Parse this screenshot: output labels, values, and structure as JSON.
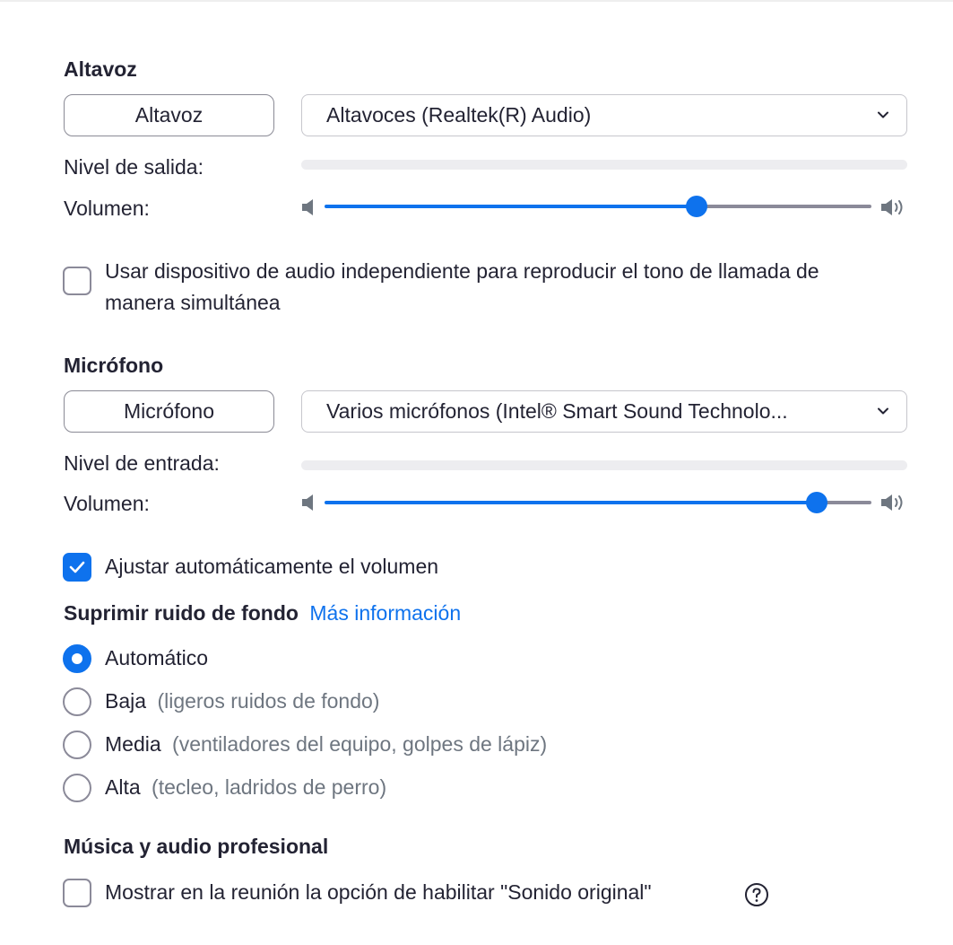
{
  "speaker": {
    "section_title": "Altavoz",
    "test_button": "Altavoz",
    "device": "Altavoces (Realtek(R) Audio)",
    "output_level_label": "Nivel de salida:",
    "output_level": 0,
    "volume_label": "Volumen:",
    "volume_fraction": 0.68
  },
  "separate_device": {
    "checked": false,
    "label_line1": "Usar dispositivo de audio independiente para reproducir el tono de llamada de",
    "label_line2": "manera simultánea"
  },
  "microphone": {
    "section_title": "Micrófono",
    "test_button": "Micrófono",
    "device": "Varios micrófonos (Intel® Smart Sound Technolo...",
    "input_level_label": "Nivel de entrada:",
    "input_level": 0,
    "volume_label": "Volumen:",
    "volume_fraction": 0.9
  },
  "auto_adjust": {
    "checked": true,
    "label": "Ajustar automáticamente el volumen"
  },
  "noise_suppression": {
    "title": "Suprimir ruido de fondo",
    "learn_more": "Más información",
    "options": [
      {
        "label": "Automático",
        "hint": "",
        "selected": true
      },
      {
        "label": "Baja",
        "hint": "(ligeros ruidos de fondo)",
        "selected": false
      },
      {
        "label": "Media",
        "hint": "(ventiladores del equipo, golpes de lápiz)",
        "selected": false
      },
      {
        "label": "Alta",
        "hint": "(tecleo, ladridos de perro)",
        "selected": false
      }
    ]
  },
  "music": {
    "section_title": "Música y audio profesional",
    "original_sound": {
      "checked": false,
      "label": "Mostrar en la reunión la opción de habilitar \"Sonido original\""
    }
  },
  "colors": {
    "accent": "#0e72ed",
    "text": "#232333",
    "muted": "#6e7680"
  },
  "icons": [
    "chevron-down-icon",
    "speaker-mute-icon",
    "speaker-loud-icon",
    "checkmark-icon",
    "help-icon"
  ]
}
